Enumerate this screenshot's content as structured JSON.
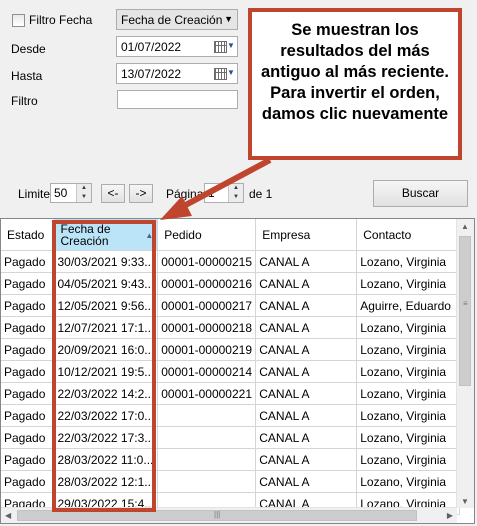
{
  "filters": {
    "filtro_fecha_label": "Filtro Fecha",
    "fecha_type_selected": "Fecha de Creación",
    "desde_label": "Desde",
    "desde_value": "01/07/2022",
    "hasta_label": "Hasta",
    "hasta_value": "13/07/2022",
    "filtro_label": "Filtro",
    "filtro_value": ""
  },
  "paging": {
    "limite_label": "Limite",
    "limite_value": "50",
    "prev_label": "<-",
    "next_label": "->",
    "pagina_label": "Página",
    "pagina_value": "1",
    "total_label": "de 1"
  },
  "buscar_label": "Buscar",
  "callout_text": "Se muestran los resultados del más antiguo al más reciente. Para invertir el orden, damos clic nuevamente",
  "colors": {
    "accent": "#c0452f",
    "sorted_header": "#bce4f8"
  },
  "grid": {
    "columns": [
      "Estado",
      "Fecha de Creación",
      "Pedido",
      "Empresa",
      "Contacto"
    ],
    "rows": [
      [
        "Pagado",
        "30/03/2021 9:33...",
        "00001-00000215",
        "CANAL A",
        "Lozano, Virginia"
      ],
      [
        "Pagado",
        "04/05/2021 9:43...",
        "00001-00000216",
        "CANAL A",
        "Lozano, Virginia"
      ],
      [
        "Pagado",
        "12/05/2021 9:56...",
        "00001-00000217",
        "CANAL A",
        "Aguirre, Eduardo"
      ],
      [
        "Pagado",
        "12/07/2021 17:1...",
        "00001-00000218",
        "CANAL A",
        "Lozano, Virginia"
      ],
      [
        "Pagado",
        "20/09/2021 16:0...",
        "00001-00000219",
        "CANAL A",
        "Lozano, Virginia"
      ],
      [
        "Pagado",
        "10/12/2021 19:5...",
        "00001-00000214",
        "CANAL A",
        "Lozano, Virginia"
      ],
      [
        "Pagado",
        "22/03/2022 14:2...",
        "00001-00000221",
        "CANAL A",
        "Lozano, Virginia"
      ],
      [
        "Pagado",
        "22/03/2022 17:0...",
        "",
        "CANAL A",
        "Lozano, Virginia"
      ],
      [
        "Pagado",
        "22/03/2022 17:3...",
        "",
        "CANAL A",
        "Lozano, Virginia"
      ],
      [
        "Pagado",
        "28/03/2022 11:0...",
        "",
        "CANAL A",
        "Lozano, Virginia"
      ],
      [
        "Pagado",
        "28/03/2022 12:1...",
        "",
        "CANAL A",
        "Lozano, Virginia"
      ],
      [
        "Pagado",
        "29/03/2022 15:4...",
        "",
        "CANAL A",
        "Lozano, Virginia"
      ]
    ]
  }
}
